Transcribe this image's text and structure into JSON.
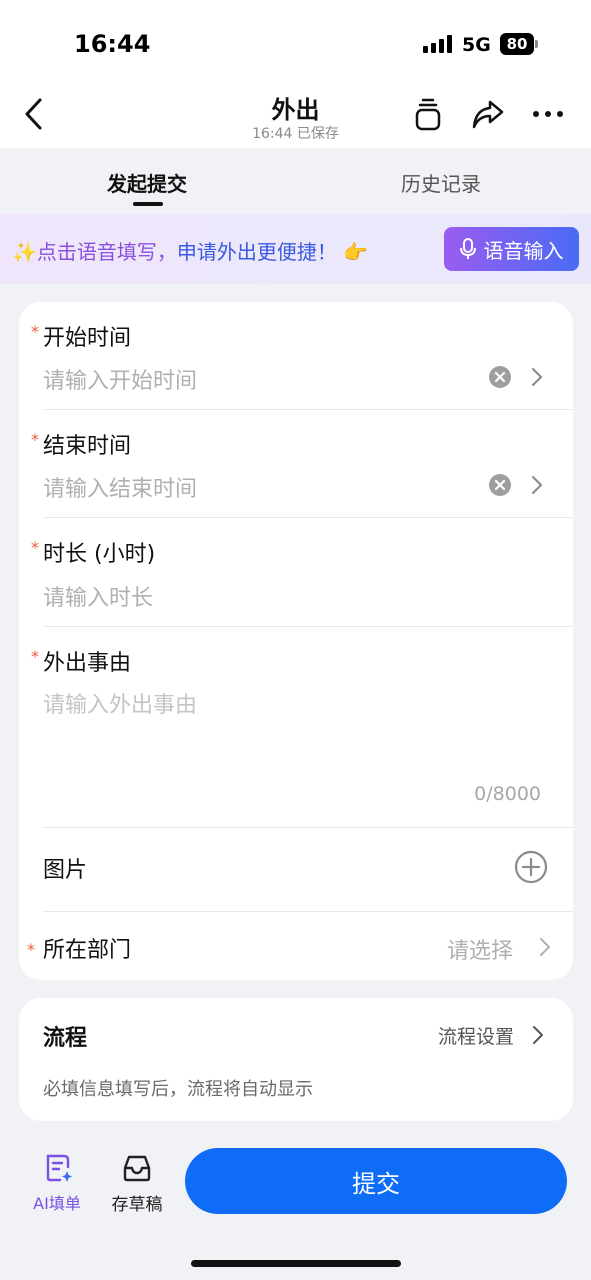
{
  "status": {
    "time": "16:44",
    "network": "5G",
    "battery": "80"
  },
  "nav": {
    "title": "外出",
    "subtitle": "16:44 已保存"
  },
  "tabs": [
    {
      "label": "发起提交",
      "active": true
    },
    {
      "label": "历史记录",
      "active": false
    }
  ],
  "banner": {
    "sparkle": "✨",
    "text_part1": "点击语音填写，",
    "text_part2": "申请外出更便捷！",
    "pointer": "👉",
    "voice_button": "语音输入"
  },
  "form": {
    "start_time": {
      "label": "开始时间",
      "placeholder": "请输入开始时间",
      "required": "*"
    },
    "end_time": {
      "label": "结束时间",
      "placeholder": "请输入结束时间",
      "required": "*"
    },
    "duration": {
      "label": "时长 (小时)",
      "placeholder": "请输入时长",
      "required": "*"
    },
    "reason": {
      "label": "外出事由",
      "placeholder": "请输入外出事由",
      "required": "*",
      "counter": "0/8000"
    },
    "images": {
      "label": "图片"
    },
    "department": {
      "label": "所在部门",
      "value": "请选择",
      "required": "*"
    }
  },
  "flow": {
    "title": "流程",
    "setting": "流程设置",
    "hint": "必填信息填写后，流程将自动显示"
  },
  "bottom": {
    "ai_label": "AI填单",
    "draft_label": "存草稿",
    "submit_label": "提交"
  },
  "colors": {
    "accent": "#0e6cf6",
    "required": "#ee5a3a",
    "ai_purple": "#7a4fe6"
  }
}
